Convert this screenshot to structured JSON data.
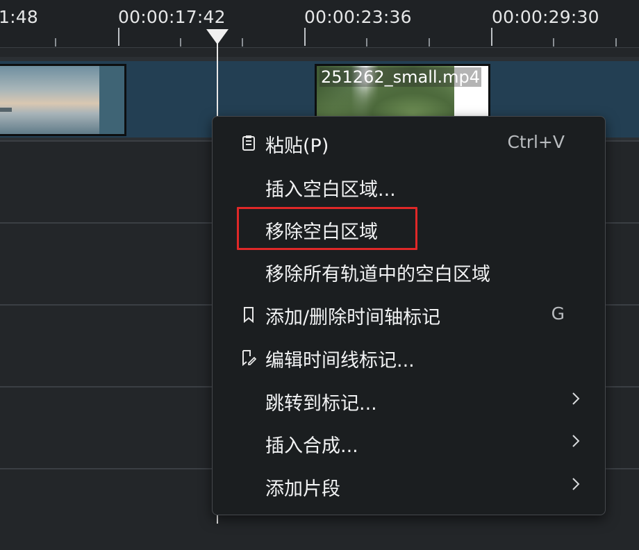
{
  "ruler": {
    "timecodes": [
      "1:48",
      "00:00:17:42",
      "00:00:23:36",
      "00:00:29:30"
    ]
  },
  "timeline": {
    "clips": [
      {
        "name": ""
      },
      {
        "name": "251262_small.mp4"
      }
    ]
  },
  "context_menu": {
    "items": [
      {
        "label": "粘贴(P)",
        "shortcut": "Ctrl+V",
        "icon": "clipboard-icon"
      },
      {
        "label": "插入空白区域..."
      },
      {
        "label": "移除空白区域"
      },
      {
        "label": "移除所有轨道中的空白区域"
      },
      {
        "label": "添加/删除时间轴标记",
        "shortcut": "G",
        "icon": "bookmark-icon"
      },
      {
        "label": "编辑时间线标记...",
        "icon": "edit-bookmark-icon"
      },
      {
        "label": "跳转到标记...",
        "submenu": true
      },
      {
        "label": "插入合成...",
        "submenu": true
      },
      {
        "label": "添加片段",
        "submenu": true
      }
    ]
  },
  "colors": {
    "highlight": "#e02828",
    "track": "#233f53",
    "menu_bg": "#1b1e20"
  }
}
